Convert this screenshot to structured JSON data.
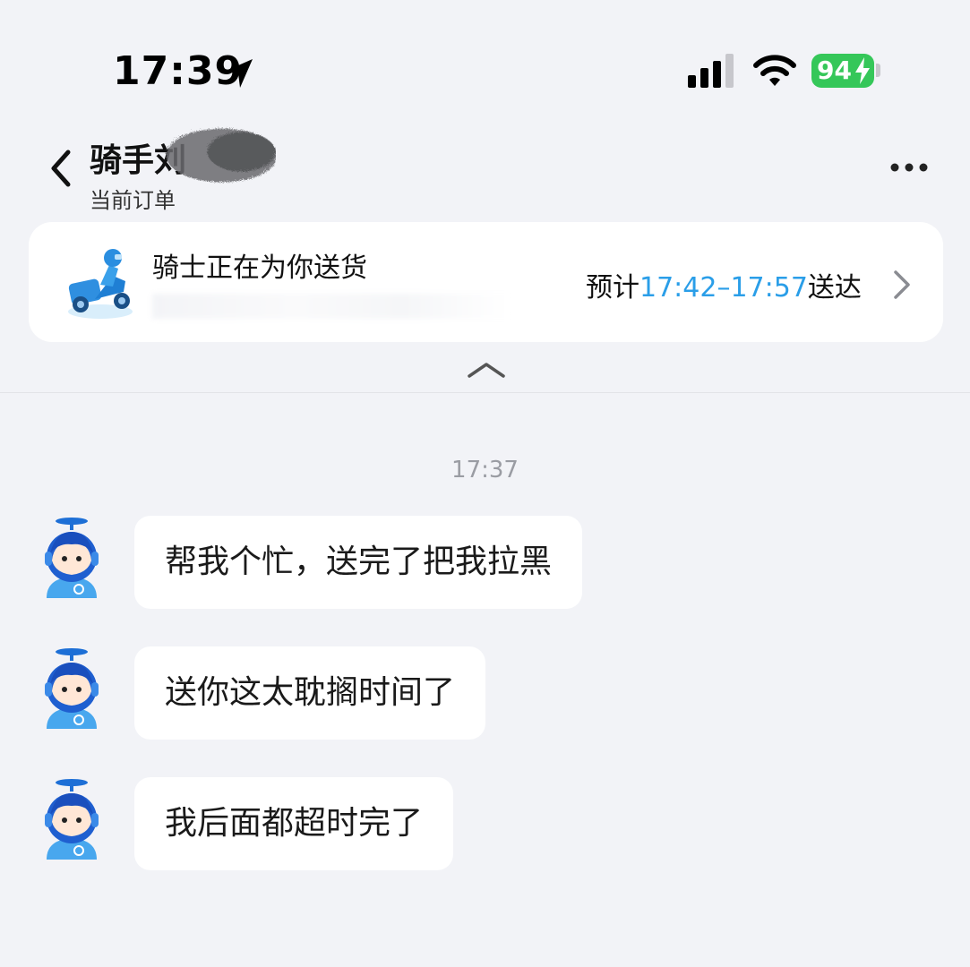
{
  "status_bar": {
    "time": "17:39",
    "battery_level": "94",
    "icons": [
      "location-arrow-icon",
      "cellular-signal-icon",
      "wifi-icon",
      "battery-icon",
      "charging-bolt-icon"
    ]
  },
  "header": {
    "title": "骑手刘",
    "subtitle": "当前订单",
    "back_icon": "chevron-left-icon",
    "more_icon": "ellipsis-icon"
  },
  "order_card": {
    "status": "骑士正在为你送货",
    "eta_prefix": "预计",
    "eta_time": "17:42–17:57",
    "eta_suffix": "送达",
    "icon": "delivery-scooter-icon",
    "chevron_icon": "chevron-right-icon"
  },
  "chat": {
    "timestamp": "17:37",
    "messages": [
      {
        "text": "帮我个忙，送完了把我拉黑"
      },
      {
        "text": "送你这太耽搁时间了"
      },
      {
        "text": "我后面都超时完了"
      }
    ]
  },
  "colors": {
    "background": "#f2f3f7",
    "accent": "#2a9ee8",
    "battery_green": "#35c759",
    "bubble": "#ffffff"
  }
}
